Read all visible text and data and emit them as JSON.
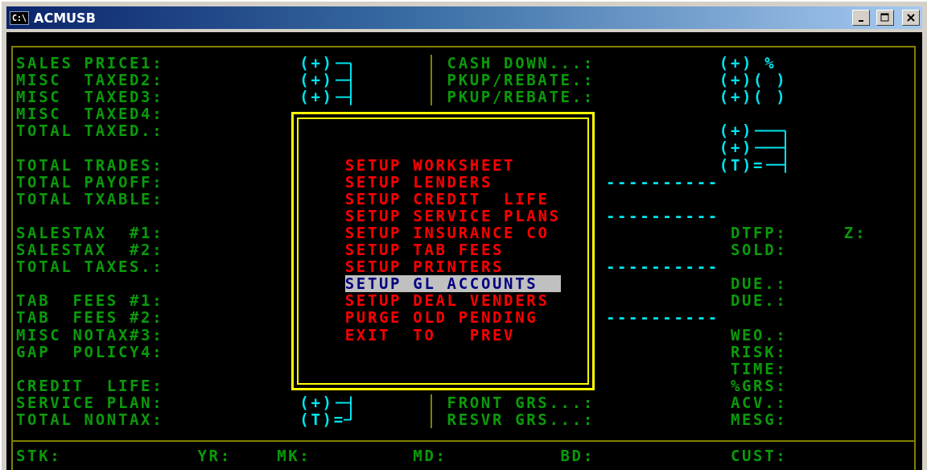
{
  "window": {
    "title": "ACMUSB",
    "icon_label": "C:\\"
  },
  "left_fields": [
    "SALES PRICE1:",
    "MISC  TAXED2:",
    "MISC  TAXED3:",
    "MISC  TAXED4:",
    "TOTAL TAXED.:",
    "TOTAL TRADES:",
    "TOTAL PAYOFF:",
    "TOTAL TXABLE:",
    "SALESTAX  #1:",
    "SALESTAX  #2:",
    "TOTAL TAXES.:",
    "TAB  FEES #1:",
    "TAB  FEES #2:",
    "MISC NOTAX#3:",
    "GAP  POLICY4:",
    "CREDIT  LIFE:",
    "SERVICE PLAN:",
    "TOTAL NONTAX:"
  ],
  "left_markers": [
    "(+)",
    "(+)",
    "(+)",
    "(+)",
    "(T)="
  ],
  "middle_fields": [
    "CASH DOWN...:",
    "PKUP/REBATE.:",
    "PKUP/REBATE.:",
    "FRONT GRS...:",
    "RESVR GRS...:"
  ],
  "right_markers": [
    "(+) %",
    "(+)( )",
    "(+)( )",
    "(+)",
    "(+)",
    "(T)="
  ],
  "dash_lines": [
    "----------",
    "----------",
    "----------",
    "----------"
  ],
  "right_fields": [
    "DTFP:",
    "Z:",
    "SOLD:",
    "DUE.:",
    "DUE.:",
    "WEO.:",
    "RISK:",
    "TIME:",
    "%GRS:",
    "ACV.:",
    "MESG:"
  ],
  "menu": {
    "items": [
      {
        "label": "SETUP WORKSHEET",
        "selected": false
      },
      {
        "label": "SETUP LENDERS",
        "selected": false
      },
      {
        "label": "SETUP CREDIT  LIFE",
        "selected": false
      },
      {
        "label": "SETUP SERVICE PLANS",
        "selected": false
      },
      {
        "label": "SETUP INSURANCE CO",
        "selected": false
      },
      {
        "label": "SETUP TAB FEES",
        "selected": false
      },
      {
        "label": "SETUP PRINTERS",
        "selected": false
      },
      {
        "label": "SETUP GL ACCOUNTS",
        "selected": true
      },
      {
        "label": "SETUP DEAL VENDERS",
        "selected": false
      },
      {
        "label": "PURGE OLD PENDING",
        "selected": false
      },
      {
        "label": "EXIT  TO   PREV",
        "selected": false
      }
    ]
  },
  "status_bar": {
    "fields": [
      "STK:",
      "YR:",
      "MK:",
      "MD:",
      "BD:",
      "CUST:"
    ]
  }
}
